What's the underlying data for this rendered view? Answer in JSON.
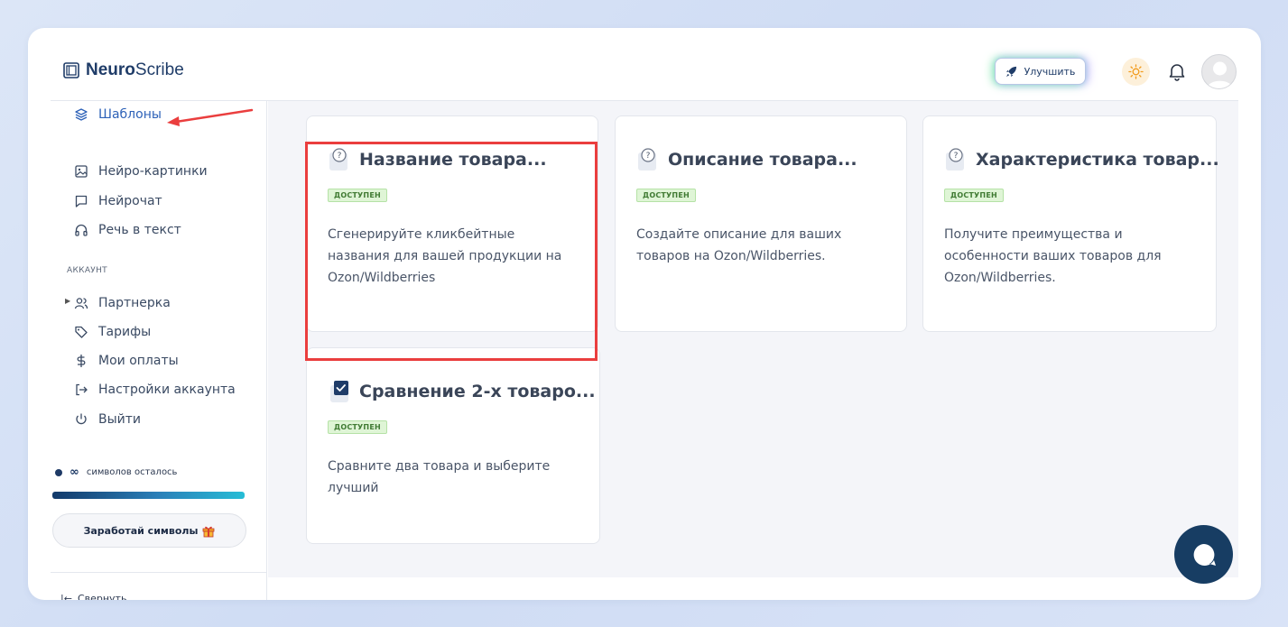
{
  "brand": {
    "bold": "Neuro",
    "light": "Scribe"
  },
  "header": {
    "upgrade_label": "Улучшить"
  },
  "sidebar": {
    "items": [
      {
        "label": "Шаблоны",
        "icon": "layers-icon",
        "active": true
      },
      {
        "label": "Нейро-картинки",
        "icon": "image-icon"
      },
      {
        "label": "Нейрочат",
        "icon": "chat-bubble-icon"
      },
      {
        "label": "Речь в текст",
        "icon": "headphones-icon"
      }
    ],
    "account_title": "АККАУНТ",
    "account_items": [
      {
        "label": "Партнерка",
        "icon": "users-icon"
      },
      {
        "label": "Тарифы",
        "icon": "tag-icon"
      },
      {
        "label": "Мои оплаты",
        "icon": "dollar-icon"
      },
      {
        "label": "Настройки аккаунта",
        "icon": "logout-arrow-icon"
      },
      {
        "label": "Выйти",
        "icon": "power-icon"
      }
    ],
    "credits_symbol": "∞",
    "credits_label": "символов осталось",
    "earn_label": "Заработай символы",
    "collapse_label": "Свернуть"
  },
  "cards": [
    {
      "title": "Название товара...",
      "badge": "ДОСТУПЕН",
      "description": "Сгенерируйте кликбейтные названия для вашей продукции на Ozon/Wildberries",
      "icon": "question-note-icon"
    },
    {
      "title": "Описание товара...",
      "badge": "ДОСТУПЕН",
      "description": "Создайте описание для ваших товаров на Ozon/Wildberries.",
      "icon": "question-note-icon"
    },
    {
      "title": "Характеристика товар...",
      "badge": "ДОСТУПЕН",
      "description": "Получите преимущества и особенности ваших товаров для Ozon/Wildberries.",
      "icon": "question-note-icon"
    },
    {
      "title": "Сравнение 2-х товаро...",
      "badge": "ДОСТУПЕН",
      "description": "Сравните два товара и выберите лучший",
      "icon": "checkbox-note-icon"
    }
  ],
  "colors": {
    "accent": "#2e62b8",
    "highlight": "#ea3e3e",
    "badge_bg": "#dff5d6",
    "chat_button": "#173d63"
  }
}
